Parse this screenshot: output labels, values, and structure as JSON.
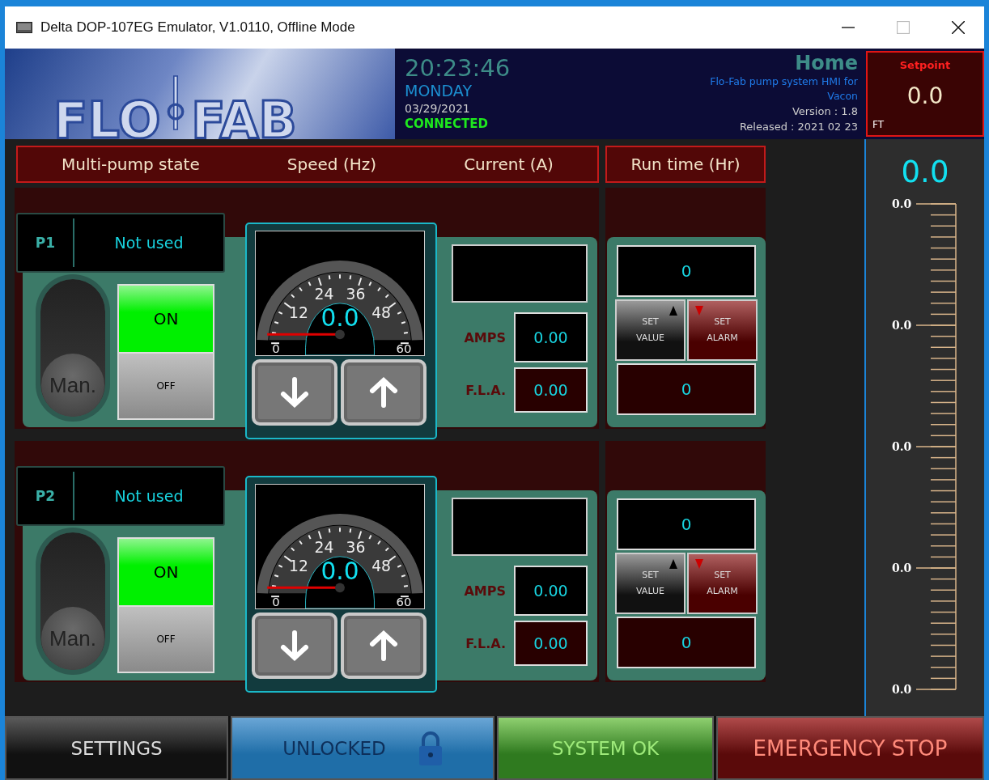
{
  "window": {
    "title": "Delta DOP-107EG Emulator, V1.0110, Offline Mode"
  },
  "logo": {
    "left": "FLO",
    "right": "FAB"
  },
  "clock": {
    "time": "20:23:46",
    "day": "MONDAY",
    "date": "03/29/2021",
    "status": "CONNECTED",
    "connected": true
  },
  "screen": {
    "title": "Home",
    "subtitle": "Flo-Fab pump system HMI for Vacon",
    "version": "Version : 1.8",
    "released": "Released : 2021 02 23"
  },
  "setpoint": {
    "label": "Setpoint",
    "value": "0.0",
    "unit": "FT"
  },
  "columns": [
    "Multi-pump state",
    "Speed (Hz)",
    "Current (A)",
    "Run time (Hr)"
  ],
  "pumps": [
    {
      "id": "P1",
      "state": "Not used",
      "mode": "Man.",
      "manual": true,
      "on_label": "ON",
      "off_label": "OFF",
      "on": true,
      "gauge": {
        "ticks": [
          "0",
          "12",
          "24",
          "36",
          "48",
          "60"
        ],
        "value": "0.0"
      },
      "amps_label": "AMPS",
      "amps": "0.00",
      "fla_label": "F.L.A.",
      "fla": "0.00",
      "runtime": "0",
      "set_value": "SET VALUE",
      "set_alarm": "SET ALARM",
      "alarm": "0"
    },
    {
      "id": "P2",
      "state": "Not used",
      "mode": "Man.",
      "manual": true,
      "on_label": "ON",
      "off_label": "OFF",
      "on": true,
      "gauge": {
        "ticks": [
          "0",
          "12",
          "24",
          "36",
          "48",
          "60"
        ],
        "value": "0.0"
      },
      "amps_label": "AMPS",
      "amps": "0.00",
      "fla_label": "F.L.A.",
      "fla": "0.00",
      "runtime": "0",
      "set_value": "SET VALUE",
      "set_alarm": "SET ALARM",
      "alarm": "0"
    }
  ],
  "level": {
    "value": "0.0",
    "scale": [
      "0.0",
      "0.0",
      "0.0",
      "0.0",
      "0.0"
    ]
  },
  "footer": [
    {
      "label": "SETTINGS",
      "kind": "settings"
    },
    {
      "label": "UNLOCKED",
      "kind": "lock"
    },
    {
      "label": "SYSTEM OK",
      "kind": "status"
    },
    {
      "label": "EMERGENCY STOP",
      "kind": "stop"
    }
  ]
}
